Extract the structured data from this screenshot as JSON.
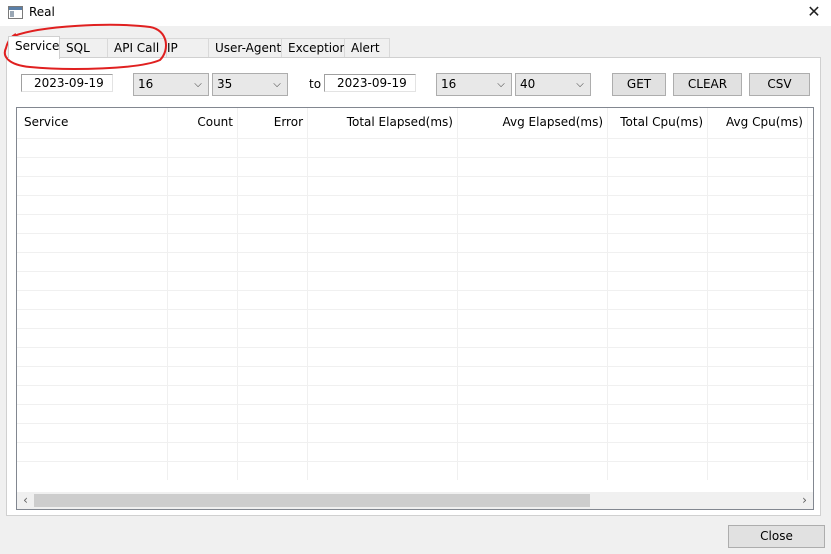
{
  "window": {
    "title": "Real",
    "close_symbol": "✕"
  },
  "tabs": [
    {
      "label": "Service",
      "active": true
    },
    {
      "label": "SQL",
      "active": false
    },
    {
      "label": "API Call",
      "active": false
    },
    {
      "label": "IP",
      "active": false
    },
    {
      "label": "User-Agent",
      "active": false
    },
    {
      "label": "Exception",
      "active": false
    },
    {
      "label": "Alert",
      "active": false
    }
  ],
  "filters": {
    "from_date": "2023-09-19",
    "from_hour": "16",
    "from_minute": "35",
    "to_label": "to",
    "to_date": "2023-09-19",
    "to_hour": "16",
    "to_minute": "40"
  },
  "buttons": {
    "get": "GET",
    "clear": "CLEAR",
    "csv": "CSV",
    "close": "Close"
  },
  "table": {
    "columns": [
      "Service",
      "Count",
      "Error",
      "Total Elapsed(ms)",
      "Avg Elapsed(ms)",
      "Total Cpu(ms)",
      "Avg Cpu(ms)"
    ],
    "rows": []
  },
  "scrollbar": {
    "left_arrow": "‹",
    "right_arrow": "›"
  },
  "annotation_color": "#e02020"
}
